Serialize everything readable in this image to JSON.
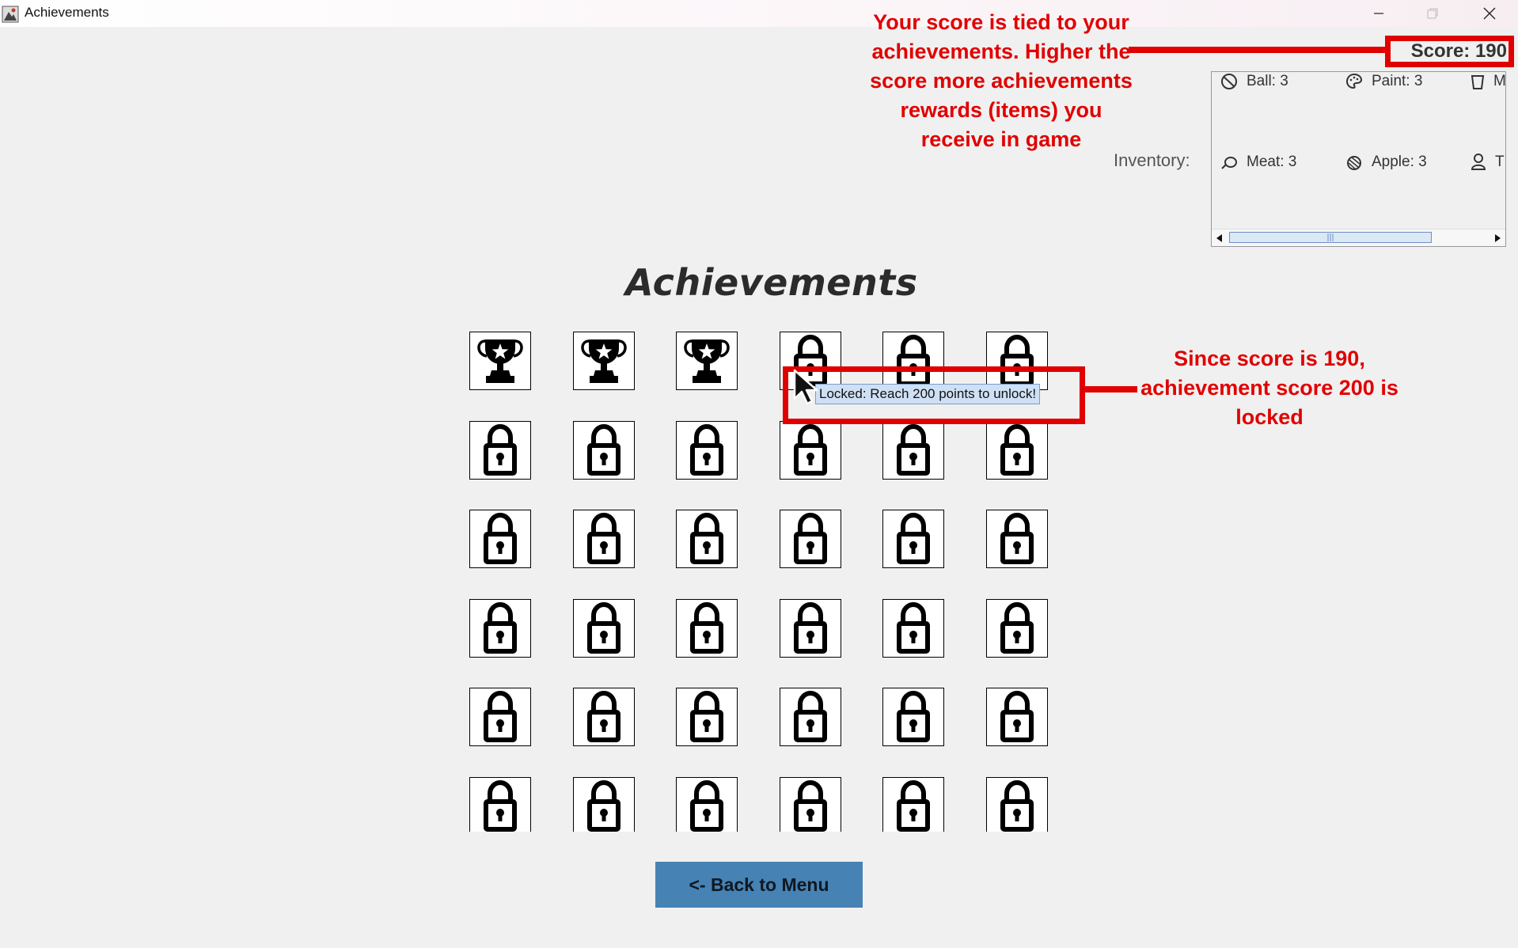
{
  "window": {
    "title": "Achievements",
    "minimize_glyph": "─",
    "maximize_glyph": "❐",
    "close_glyph": "✕"
  },
  "score": {
    "label": "Score: 190",
    "value": 190
  },
  "annotations": {
    "score_note": "Your score is tied to your achievements. Higher the score more achievements rewards (items) you receive in game",
    "locked_note": "Since score is 190, achievement score 200 is locked"
  },
  "inventory": {
    "label": "Inventory:",
    "items": [
      {
        "icon": "ball-icon",
        "text": "Ball: 3"
      },
      {
        "icon": "paint-palette-icon",
        "text": "Paint: 3"
      },
      {
        "icon": "cup-icon",
        "text": "M"
      },
      {
        "icon": "meat-icon",
        "text": "Meat: 3"
      },
      {
        "icon": "apple-icon",
        "text": "Apple: 3"
      },
      {
        "icon": "toy-icon",
        "text": "T"
      }
    ],
    "scrollbar": {
      "thumb_position": 0.0,
      "thumb_fraction": 0.72
    }
  },
  "achievements": {
    "heading": "Achievements",
    "columns": 6,
    "visible_rows": 6,
    "unlocked_count": 3,
    "tooltip": "Locked: Reach 200 points to unlock!"
  },
  "back_button": {
    "label": "<- Back to Menu"
  },
  "colors": {
    "annotation_red": "#e00000",
    "button_blue": "#4682b4",
    "tooltip_bg": "#cfe0f5",
    "background": "#f0f0f0"
  }
}
